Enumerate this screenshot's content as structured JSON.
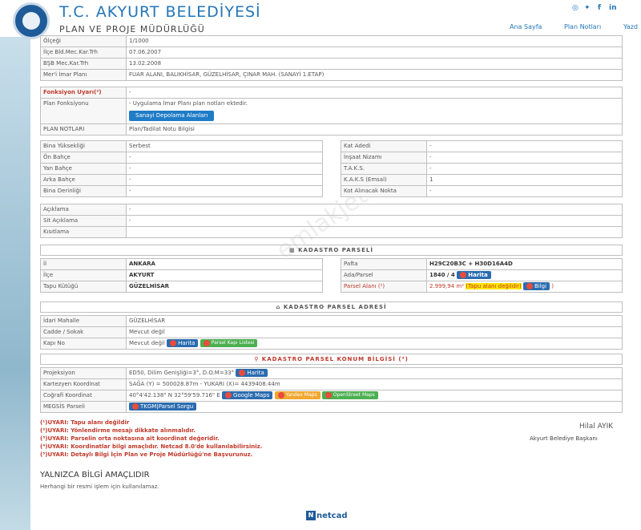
{
  "header": {
    "title": "T.C. AKYURT BELEDİYESİ",
    "subtitle": "PLAN VE PROJE MÜDÜRLÜĞÜ",
    "social": [
      "instagram-icon",
      "twitter-icon",
      "facebook-icon",
      "linkedin-icon"
    ],
    "nav": [
      "Ana Sayfa",
      "Plan Notları",
      "Yazd"
    ]
  },
  "watermark": "emlakjet.com",
  "plan_info": [
    {
      "label": "Ölçeği",
      "value": "1/1000"
    },
    {
      "label": "İlçe Bld.Mec.Kar.Trh",
      "value": "07.06.2007"
    },
    {
      "label": "BŞB Mec.Kar.Trh",
      "value": "13.02.2008"
    },
    {
      "label": "Mer'i İmar Planı",
      "value": "FUAR ALANI, BALIKHİSAR, GÜZELHİSAR, ÇINAR MAH. (SANAYİ 1.ETAP)"
    }
  ],
  "function": {
    "warning_label": "Fonksiyon Uyarı(²)",
    "warning_value": "-",
    "plan_label": "Plan Fonksiyonu",
    "plan_value": "- Uygulama İmar Planı plan notları ektedir.",
    "depo_button": "Sanayi Depolama Alanları",
    "notes_label": "PLAN NOTLARI",
    "notes_value": "Plan/Tadilat Notu Bilgisi"
  },
  "building_left": [
    {
      "label": "Bina Yüksekliği",
      "value": "Serbest"
    },
    {
      "label": "Ön Bahçe",
      "value": "-"
    },
    {
      "label": "Yan Bahçe",
      "value": "-"
    },
    {
      "label": "Arka Bahçe",
      "value": "-"
    },
    {
      "label": "Bina Derinliği",
      "value": "-"
    }
  ],
  "building_right": [
    {
      "label": "Kat Adedi",
      "value": "-"
    },
    {
      "label": "İnşaat Nizamı",
      "value": "-"
    },
    {
      "label": "T.A.K.S.",
      "value": "-"
    },
    {
      "label": "K.A.K.S (Emsal)",
      "value": "1"
    },
    {
      "label": "Kot Alınacak Nokta",
      "value": "-"
    }
  ],
  "descriptions": [
    {
      "label": "Açıklama",
      "value": "-"
    },
    {
      "label": "Sit Açıklama",
      "value": "-"
    },
    {
      "label": "Kısıtlama",
      "value": ""
    }
  ],
  "kadastro": {
    "title": "KADASTRO PARSELİ",
    "left": [
      {
        "label": "İl",
        "value": "ANKARA"
      },
      {
        "label": "İlçe",
        "value": "AKYURT"
      },
      {
        "label": "Tapu Kütüğü",
        "value": "GÜZELHİSAR"
      }
    ],
    "pafta_label": "Pafta",
    "pafta_value": "H29C20B3C + H30D16A4D",
    "ada_label": "Ada/Parsel",
    "ada_value": "1840 / 4",
    "alan_label": "Parsel Alanı (¹)",
    "alan_value": "2.999,94 m²",
    "alan_note": "(Tapu alanı değildir)",
    "harita_btn": "Harita",
    "bilgi_btn": "Bilgi"
  },
  "address": {
    "title": "KADASTRO PARSEL ADRESİ",
    "rows": [
      {
        "label": "İdari Mahalle",
        "value": "GÜZELHİSAR"
      },
      {
        "label": "Cadde / Sokak",
        "value": "Mevcut değil"
      },
      {
        "label": "Kapı No",
        "value": "Mevcut değil"
      }
    ],
    "harita_btn": "Harita",
    "kapi_btn": "Parsel Kapı Listesi"
  },
  "konum": {
    "title": "KADASTRO PARSEL KONUM BİLGİSİ (³)",
    "projeksiyon_label": "Projeksiyon",
    "projeksiyon_value": "ED50, Dilim Genişliği=3°, D.O.M=33°",
    "kartezyen_label": "Kartezyen Koordinat",
    "kartezyen_value": "SAĞA (Y) = 500028.87m - YUKARI (X)= 4439408.44m",
    "cografi_label": "Coğrafi Koordinat",
    "cografi_value": "40°4'42.138\" N 32°59'59.716\" E",
    "google_btn": "Google Maps",
    "yandex_btn": "Yandex Maps",
    "osm_btn": "OpenStreet Maps",
    "megsis_label": "MEGSİS Parseli",
    "tkgm_btn": "TKGM|Parsel Sorgu",
    "harita_btn": "Harita"
  },
  "notes": [
    "(¹)UYARI: Tapu alanı değildir",
    "(²)UYARI: Yönlendirme mesajı dikkate alınmalıdır.",
    "(³)UYARI: Parselin orta noktasına ait koordinat değeridir.",
    "(⁴)UYARI: Koordinatlar bilgi amaçlıdır. Netcad 8.0'de kullanılabilirsiniz.",
    "(⁵)UYARI: Detaylı Bilgi İçin Plan ve Proje Müdürlüğü'ne Başvurunuz."
  ],
  "signature": {
    "name": "Hilal AYIK",
    "title": "Akyurt Belediye Başkanı"
  },
  "disclaimer": {
    "title": "YALNIZCA BİLGİ AMAÇLIDIR",
    "text": "Herhangi bir resmi işlem için kullanılamaz."
  },
  "footer": {
    "brand": "netcad"
  }
}
